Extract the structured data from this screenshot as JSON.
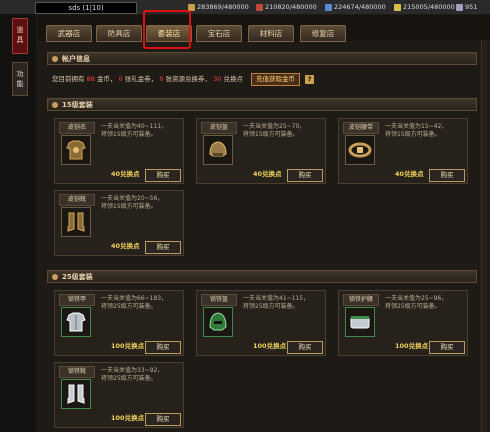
{
  "topbar": {
    "player": "sds (1|10)",
    "resources": [
      {
        "value": "283869/480000",
        "color": "#c9a04a",
        "icon": "gold-coin-icon"
      },
      {
        "value": "210820/480000",
        "color": "#c24a3a",
        "icon": "wood-icon"
      },
      {
        "value": "224674/480000",
        "color": "#5a8ad6",
        "icon": "ore-icon"
      },
      {
        "value": "215005/480000",
        "color": "#d6c04a",
        "icon": "grain-icon"
      },
      {
        "value": "951",
        "color": "#a0a0c0",
        "icon": "gem-icon"
      }
    ]
  },
  "side_tabs": [
    {
      "label": "道具",
      "active": true
    },
    {
      "label": "功能",
      "active": false
    }
  ],
  "tabs": [
    {
      "label": "武器店",
      "active": false
    },
    {
      "label": "防具店",
      "active": false
    },
    {
      "label": "套装店",
      "active": true
    },
    {
      "label": "宝石店",
      "active": false
    },
    {
      "label": "材料店",
      "active": false
    },
    {
      "label": "修复店",
      "active": false
    }
  ],
  "account": {
    "title": "帐户信息",
    "t1": "您目前拥有",
    "v1": "88",
    "t2": "金币，",
    "v2": "0",
    "t3": "张礼金券，",
    "v3": "0",
    "t4": "张资源兑换券，",
    "v4": "30",
    "t5": "兑换点",
    "recharge": "充值获取金币",
    "help": "?"
  },
  "section15": {
    "title": "15级套装",
    "items": [
      {
        "name": "皮铠衣",
        "desc": "一夫当关值为40~111，\n将领15级方可装备。",
        "price": "40兑换点",
        "buy": "购买",
        "icon": "leather-armor-icon"
      },
      {
        "name": "皮铠盔",
        "desc": "一夫当关值为25~70，\n将领15级方可装备。",
        "price": "40兑换点",
        "buy": "购买",
        "icon": "leather-helmet-icon"
      },
      {
        "name": "皮铠腰带",
        "desc": "一夫当关值为15~42，\n将领15级方可装备。",
        "price": "40兑换点",
        "buy": "购买",
        "icon": "leather-belt-icon"
      },
      {
        "name": "皮铠靴",
        "desc": "一夫当关值为20~56，\n将领15级方可装备。",
        "price": "40兑换点",
        "buy": "购买",
        "icon": "leather-boots-icon"
      }
    ]
  },
  "section25": {
    "title": "25级套装",
    "items": [
      {
        "name": "锁铁甲",
        "desc": "一夫当关值为66~183，\n将领25级方可装备。",
        "price": "100兑换点",
        "buy": "购买",
        "icon": "iron-armor-icon"
      },
      {
        "name": "锁铁盔",
        "desc": "一夫当关值为41~115，\n将领25级方可装备。",
        "price": "100兑换点",
        "buy": "购买",
        "icon": "iron-helmet-icon"
      },
      {
        "name": "锁铁护腰",
        "desc": "一夫当关值为25~96，\n将领25级方可装备。",
        "price": "100兑换点",
        "buy": "购买",
        "icon": "iron-waist-icon"
      },
      {
        "name": "锁铁靴",
        "desc": "一夫当关值为33~92，\n将领25级方可装备。",
        "price": "100兑换点",
        "buy": "购买",
        "icon": "iron-boots-icon"
      }
    ]
  }
}
